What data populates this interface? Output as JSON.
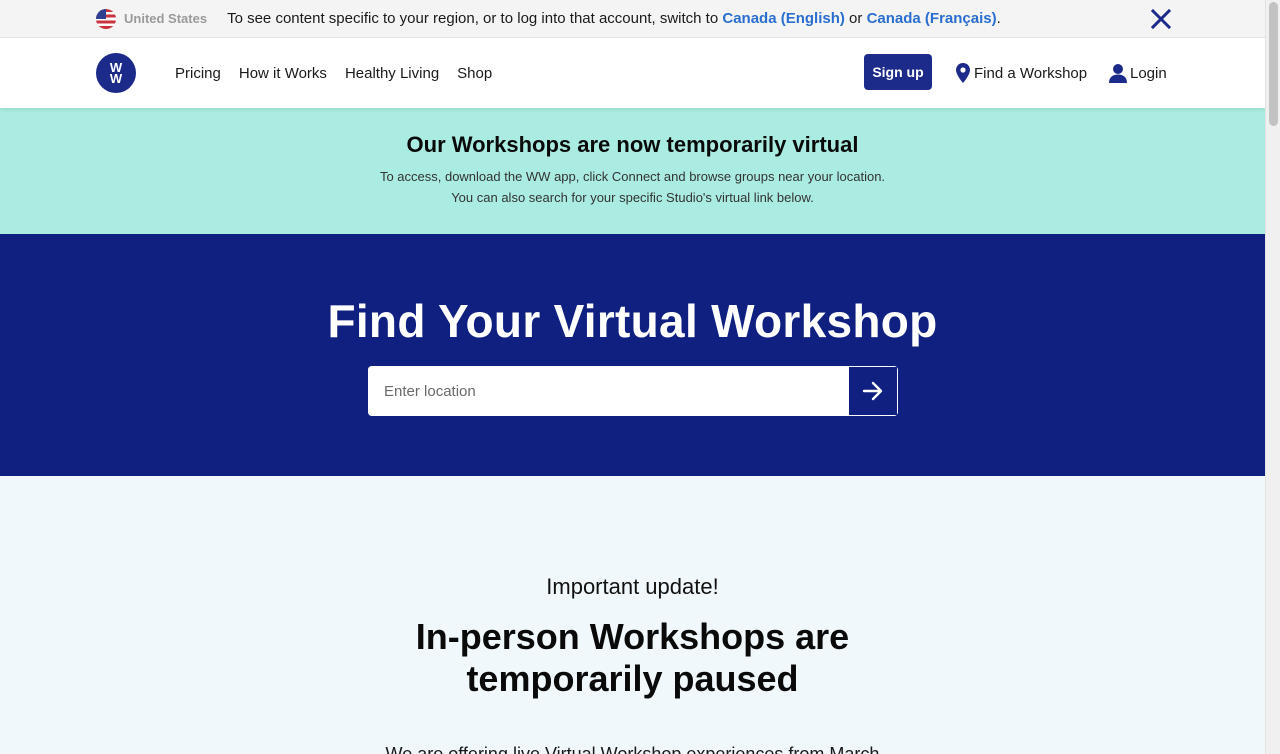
{
  "region_banner": {
    "country": "United States",
    "message_prefix": "To see content specific to your region, or to log into that account, switch to ",
    "link_en": "Canada (English)",
    "message_or": " or ",
    "link_fr": "Canada (Français)",
    "message_suffix": "."
  },
  "nav": {
    "logo_top": "W",
    "logo_bottom": "W",
    "links": [
      "Pricing",
      "How it Works",
      "Healthy Living",
      "Shop"
    ],
    "signup_label": "Sign up",
    "find_workshop_label": "Find a Workshop",
    "login_label": "Login"
  },
  "notice": {
    "title": "Our Workshops are now temporarily virtual",
    "line1": "To access, download the WW app, click Connect and browse groups near your location.",
    "line2": "You can also search for your specific Studio's virtual link below."
  },
  "hero": {
    "title": "Find Your Virtual Workshop",
    "search_placeholder": "Enter location"
  },
  "update": {
    "kicker": "Important update!",
    "heading_line1": "In-person Workshops are",
    "heading_line2": "temporarily paused",
    "body": "We are offering live Virtual Workshop experiences from March"
  },
  "colors": {
    "brand_navy": "#0f2080",
    "notice_mint": "#aaece1",
    "link_blue": "#2a6fcf"
  }
}
